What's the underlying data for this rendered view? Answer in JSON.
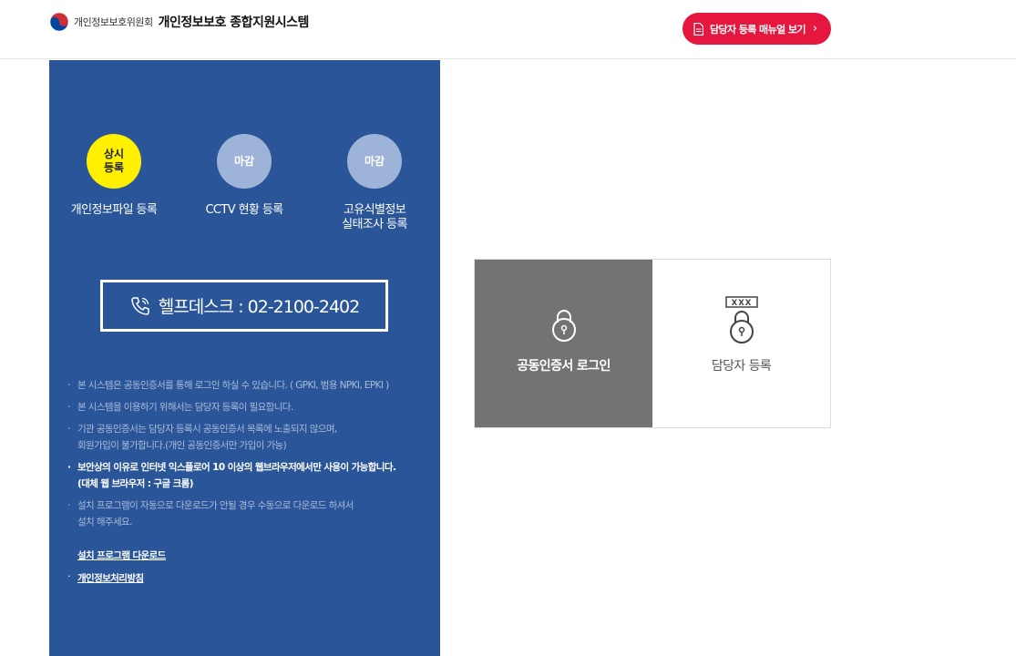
{
  "header": {
    "org_name": "개인정보보호위원회",
    "system_name": "개인정보보호 종합지원시스템",
    "manual_button": "담당자 등록 매뉴얼 보기",
    "manual_chevron": "›"
  },
  "registrations": [
    {
      "status": "상시\n등록",
      "label": "개인정보파일 등록",
      "state": "open"
    },
    {
      "status": "마감",
      "label": "CCTV 현황 등록",
      "state": "closed"
    },
    {
      "status": "마감",
      "label": "고유식별정보\n실태조사 등록",
      "state": "closed"
    }
  ],
  "helpdesk": "헬프데스크 : 02-2100-2402",
  "notes": [
    "본 시스템은 공동인증서를 통해 로그인 하실 수 있습니다. ( GPKI, 범용 NPKI, EPKI )",
    "본 시스템을 이용하기 위해서는 담당자 등록이 필요합니다.",
    "기관 공동인증서는 담당자 등록시 공동인증서 목록에 노출되지 않으며,\n회원가입이 불가합니다.(개인 공동인증서만 가입이 가능)",
    "보안상의 이유로 인터넷 익스플로어 10 이상의 웹브라우저에서만 사용이 가능합니다.\n(대체 웹 브라우저 : 구글 크롬)",
    "설치 프로그램이 자동으로 다운로드가 안될 경우 수동으로 다운로드 하셔서\n설치 해주세요."
  ],
  "links": {
    "install_download": "설치 프로그램 다운로드",
    "privacy_policy": "개인정보처리방침"
  },
  "login": {
    "cert_login": "공동인증서 로그인",
    "register": "담당자 등록",
    "password_mask": "XXX"
  },
  "colors": {
    "panel": "#2a5699",
    "accent_red": "#e5173e",
    "active_status": "#fff000",
    "closed_status": "#9db3d8",
    "login_tile": "#737373"
  }
}
